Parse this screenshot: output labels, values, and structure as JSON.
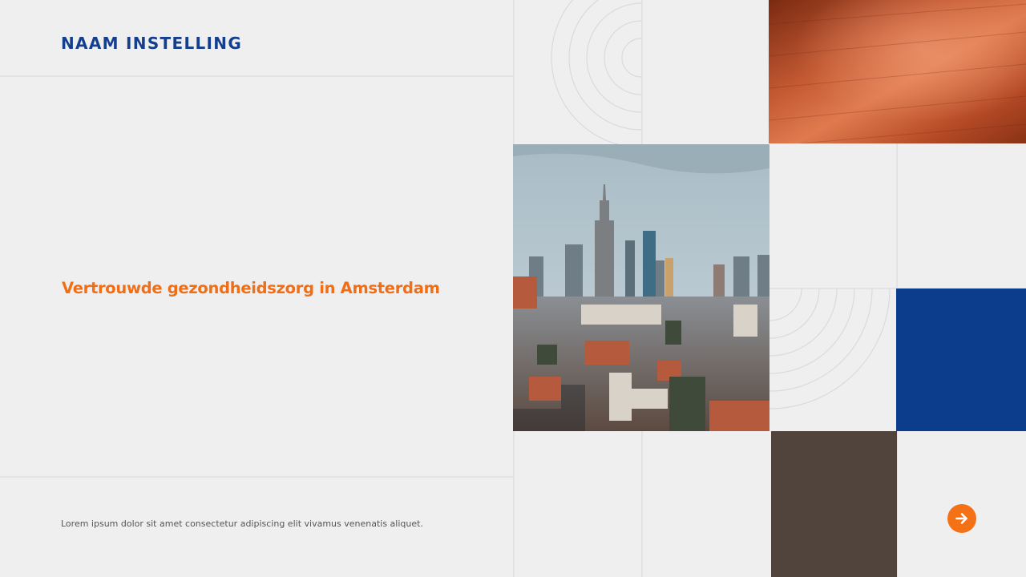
{
  "header": {
    "institution_name": "NAAM INSTELLING"
  },
  "hero": {
    "tagline": "Vertrouwde gezondheidszorg in Amsterdam"
  },
  "footer": {
    "body_text": "Lorem ipsum dolor sit amet consectetur adipiscing elit vivamus venenatis aliquet."
  },
  "navigation": {
    "next_icon": "arrow-right-icon"
  },
  "tiles": {
    "copper_image": "copper-texture-photo",
    "city_image": "city-skyline-photo",
    "blue_block": "#0c3d8c",
    "brown_block": "#51443d"
  },
  "colors": {
    "background": "#f0eff0",
    "brand_blue": "#143f8c",
    "accent_orange": "#f26e14",
    "body_text": "#555458"
  }
}
